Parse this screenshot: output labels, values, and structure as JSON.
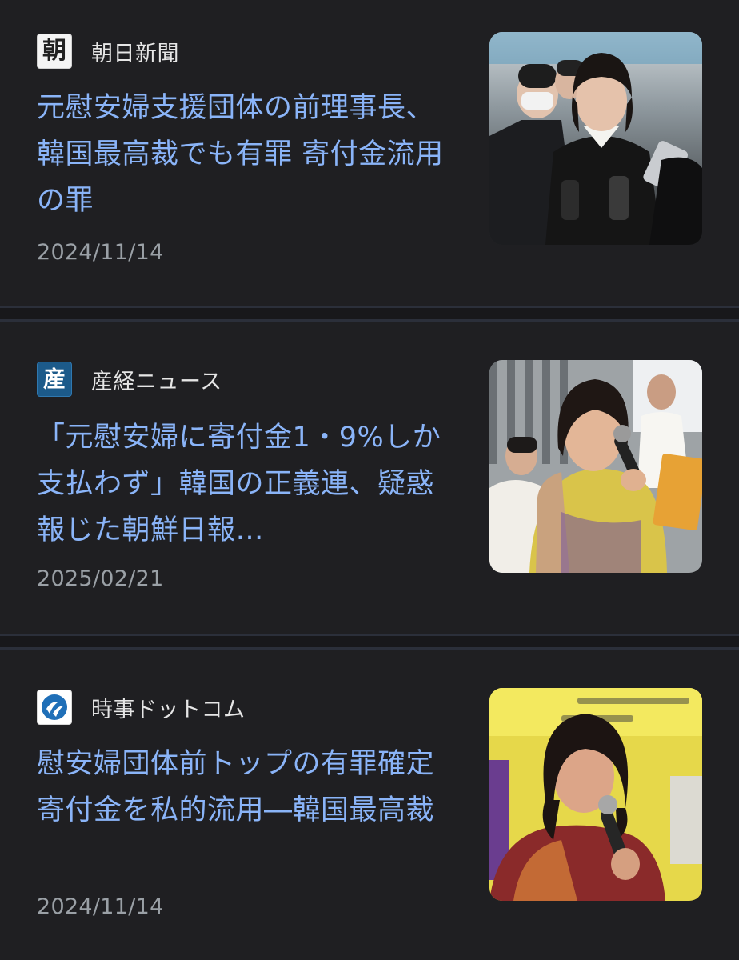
{
  "articles": [
    {
      "source": "朝日新聞",
      "source_logo_icon": "asahi-logo-icon",
      "source_logo_text": "朝",
      "headline": "元慰安婦支援団体の前理事長、韓国最高裁でも有罪 寄付金流用の罪",
      "date": "2024/11/14"
    },
    {
      "source": "産経ニュース",
      "source_logo_icon": "sankei-logo-icon",
      "source_logo_text": "産",
      "headline": "「元慰安婦に寄付金1・9%しか支払わず」韓国の正義連、疑惑報じた朝鮮日報…",
      "date": "2025/02/21"
    },
    {
      "source": "時事ドットコム",
      "source_logo_icon": "jiji-logo-icon",
      "headline": "慰安婦団体前トップの有罪確定 寄付金を私的流用―韓国最高裁",
      "date": "2024/11/14"
    }
  ],
  "colors": {
    "background": "#1f1f22",
    "divider": "#18181b",
    "headline": "#8ab4f8",
    "source_name": "#e6e6e6",
    "date": "#9aa0a6"
  }
}
